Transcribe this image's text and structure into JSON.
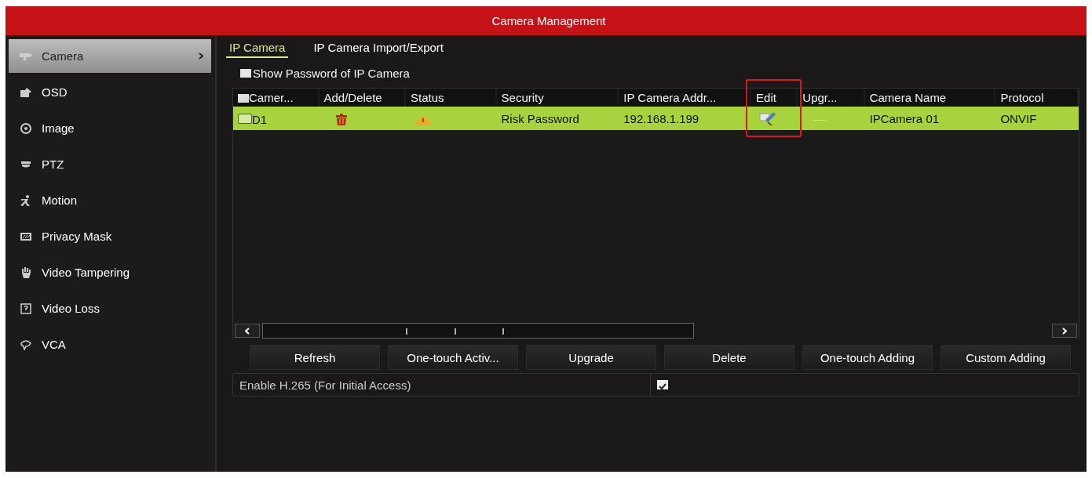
{
  "window": {
    "title": "Camera Management"
  },
  "sidebar": {
    "items": [
      {
        "label": "Camera",
        "kind": "camera",
        "selected": true
      },
      {
        "label": "OSD",
        "kind": "osd",
        "selected": false
      },
      {
        "label": "Image",
        "kind": "image",
        "selected": false
      },
      {
        "label": "PTZ",
        "kind": "ptz",
        "selected": false
      },
      {
        "label": "Motion",
        "kind": "motion",
        "selected": false
      },
      {
        "label": "Privacy Mask",
        "kind": "mask",
        "selected": false
      },
      {
        "label": "Video Tampering",
        "kind": "hand",
        "selected": false
      },
      {
        "label": "Video Loss",
        "kind": "loss",
        "selected": false
      },
      {
        "label": "VCA",
        "kind": "vca",
        "selected": false
      }
    ]
  },
  "tabs": [
    {
      "label": "IP Camera",
      "selected": true
    },
    {
      "label": "IP Camera Import/Export",
      "selected": false
    }
  ],
  "show_password": {
    "label": "Show Password of IP Camera",
    "checked": false
  },
  "table": {
    "header_checked": false,
    "columns": [
      {
        "label": "Camer...",
        "highlighted": false
      },
      {
        "label": "Add/Delete",
        "highlighted": false
      },
      {
        "label": "Status",
        "highlighted": false
      },
      {
        "label": "Security",
        "highlighted": false
      },
      {
        "label": "IP Camera Addr...",
        "highlighted": false
      },
      {
        "label": "Edit",
        "highlighted": true
      },
      {
        "label": "Upgr...",
        "highlighted": false
      },
      {
        "label": "Camera Name",
        "highlighted": false
      },
      {
        "label": "Protocol",
        "highlighted": false
      }
    ],
    "rows": [
      {
        "selected": true,
        "checked": false,
        "camera": "D1",
        "security": "Risk Password",
        "ip": "192.168.1.199",
        "upgrade": "—",
        "name": "IPCamera 01",
        "protocol": "ONVIF"
      }
    ]
  },
  "buttons": [
    "Refresh",
    "One-touch Activ...",
    "Upgrade",
    "Delete",
    "One-touch Adding",
    "Custom Adding"
  ],
  "h265": {
    "label": "Enable H.265 (For Initial Access)",
    "checked": true
  }
}
